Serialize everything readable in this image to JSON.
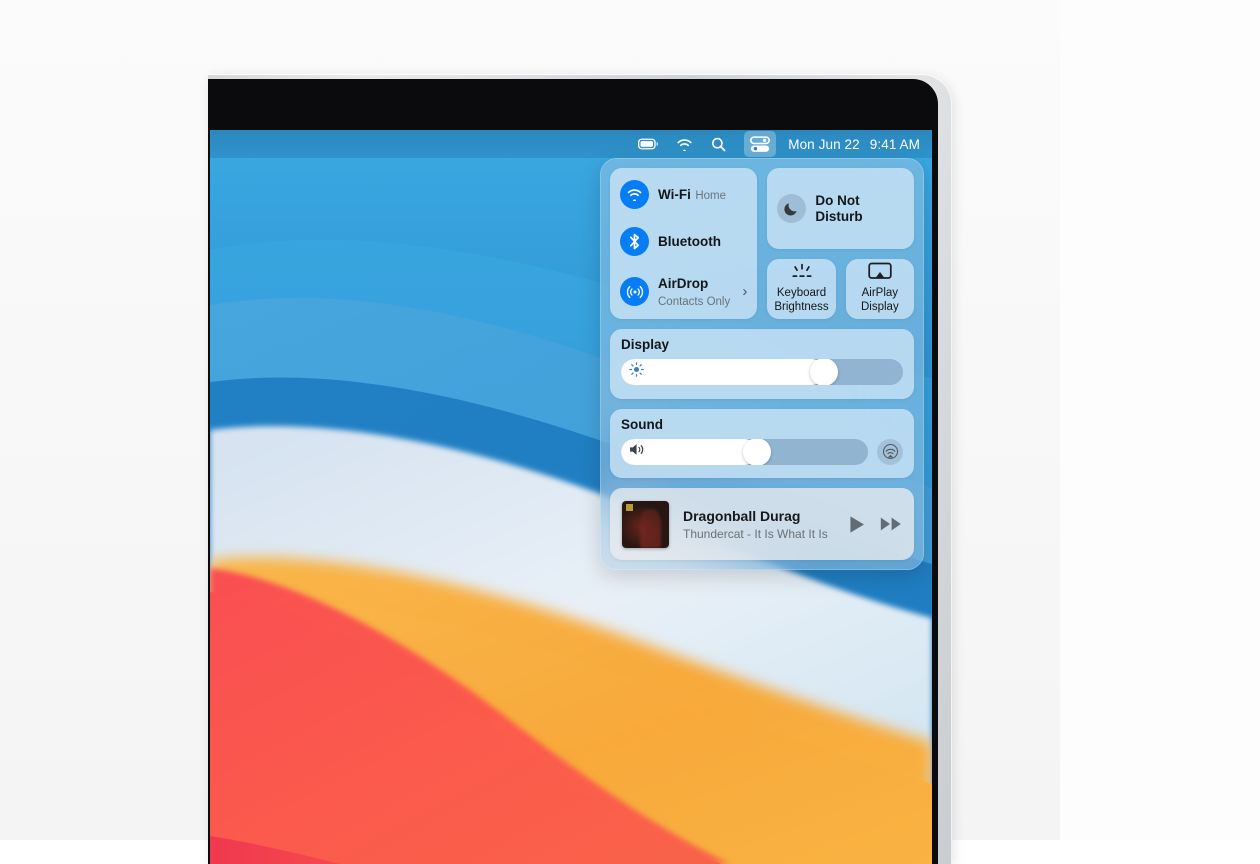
{
  "menubar": {
    "icons": [
      "battery-icon",
      "wifi-icon",
      "search-icon",
      "control-center-icon"
    ],
    "date": "Mon Jun 22",
    "time": "9:41 AM"
  },
  "control_center": {
    "connectivity": [
      {
        "icon": "wifi-icon",
        "title": "Wi-Fi",
        "subtitle": "Home"
      },
      {
        "icon": "bluetooth-icon",
        "title": "Bluetooth",
        "subtitle": ""
      },
      {
        "icon": "airdrop-icon",
        "title": "AirDrop",
        "subtitle": "Contacts Only",
        "chevron": "›"
      }
    ],
    "do_not_disturb": {
      "icon": "moon-icon",
      "label_line1": "Do Not",
      "label_line2": "Disturb"
    },
    "tiles": [
      {
        "icon": "keyboard-brightness-icon",
        "label_line1": "Keyboard",
        "label_line2": "Brightness"
      },
      {
        "icon": "airplay-display-icon",
        "label_line1": "AirPlay",
        "label_line2": "Display"
      }
    ],
    "display": {
      "title": "Display",
      "icon": "brightness-icon",
      "value_percent": 72
    },
    "sound": {
      "title": "Sound",
      "icon": "speaker-icon",
      "value_percent": 55,
      "airplay_button_icon": "airplay-audio-icon"
    },
    "now_playing": {
      "artwork": "album-artwork",
      "title": "Dragonball Durag",
      "subtitle": "Thundercat - It Is What It Is",
      "controls": [
        {
          "icon": "play-icon"
        },
        {
          "icon": "fast-forward-icon"
        }
      ]
    }
  },
  "colors": {
    "accent_blue": "#067cf5",
    "panel_tint": "#a6c7e2",
    "module_tint": "#d6e9f8",
    "wallpaper_blue": "#2887cd",
    "wallpaper_orange": "#f7a93b",
    "wallpaper_red": "#f9534b"
  }
}
